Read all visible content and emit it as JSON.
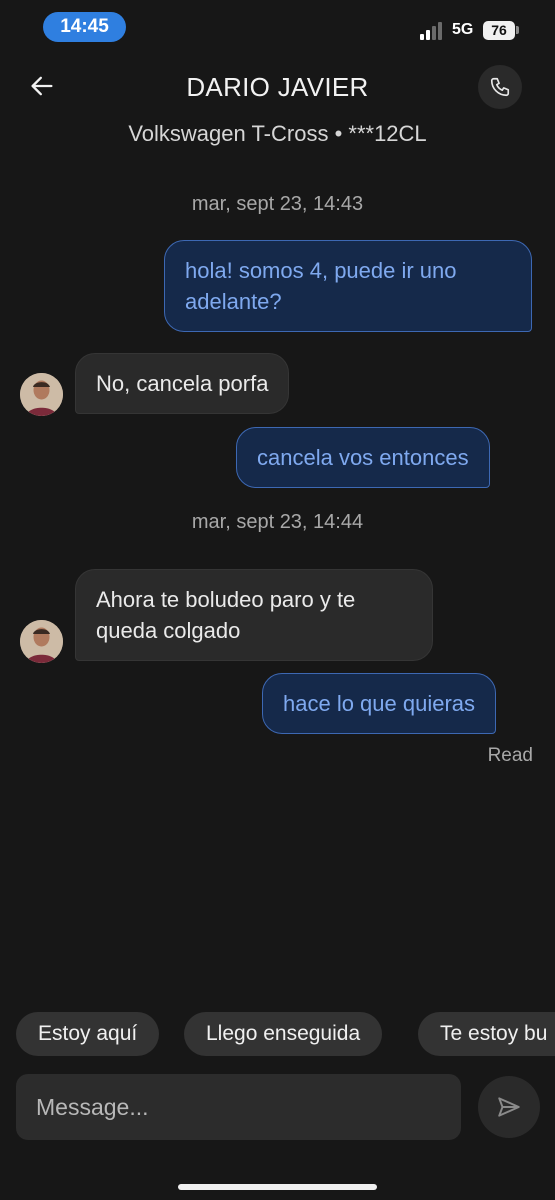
{
  "status_bar": {
    "time": "14:45",
    "network": "5G",
    "battery": "76"
  },
  "header": {
    "title": "DARIO JAVIER",
    "subtitle": "Volkswagen T-Cross • ***12CL",
    "back_icon": "arrow-left-icon",
    "call_icon": "phone-icon"
  },
  "chat": {
    "timestamps": [
      "mar, sept 23, 14:43",
      "mar, sept 23, 14:44"
    ],
    "messages": [
      {
        "direction": "outgoing",
        "text": "hola! somos 4, puede ir uno adelante?"
      },
      {
        "direction": "incoming",
        "text": "No, cancela porfa"
      },
      {
        "direction": "outgoing",
        "text": "cancela vos entonces"
      },
      {
        "direction": "incoming",
        "text": "Ahora te boludeo paro y te queda colgado"
      },
      {
        "direction": "outgoing",
        "text": "hace lo que quieras"
      }
    ],
    "read_receipt": "Read"
  },
  "quick_replies": [
    "Estoy aquí",
    "Llego enseguida",
    "Te estoy bu"
  ],
  "composer": {
    "placeholder": "Message...",
    "value": "",
    "send_icon": "send-icon"
  },
  "colors": {
    "background": "#171717",
    "outgoing_bubble": "#15294a",
    "outgoing_border": "#3d68b3",
    "outgoing_text": "#7fa9ef",
    "incoming_bubble": "#2a2a2a",
    "time_pill": "#2f7fe0"
  }
}
